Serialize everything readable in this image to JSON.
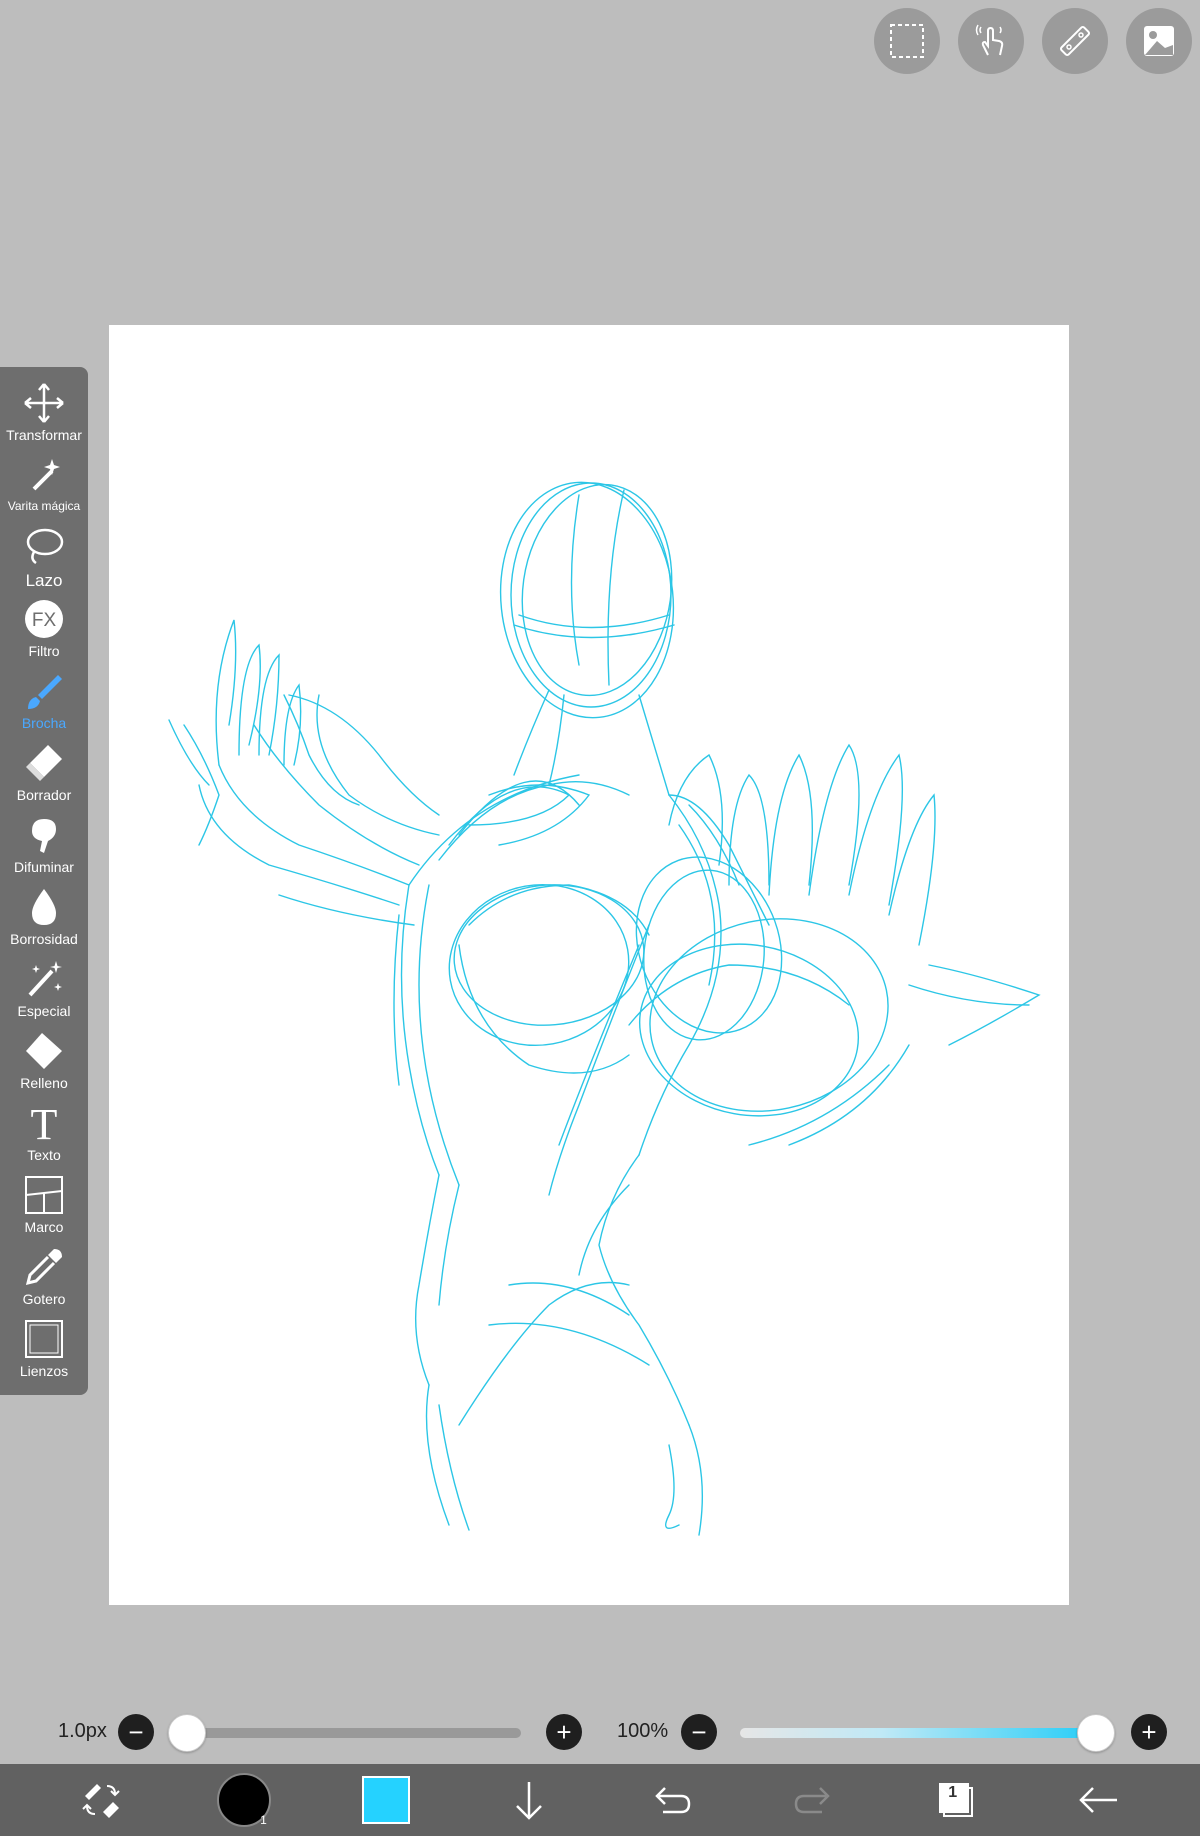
{
  "top_buttons": [
    {
      "name": "selection-icon"
    },
    {
      "name": "gesture-icon"
    },
    {
      "name": "ruler-icon"
    },
    {
      "name": "material-icon"
    }
  ],
  "toolbar": {
    "tools": [
      {
        "id": "transformar",
        "label": "Transformar",
        "icon": "move-icon"
      },
      {
        "id": "varita",
        "label": "Varita mágica",
        "icon": "magic-wand-icon"
      },
      {
        "id": "lazo",
        "label": "Lazo",
        "icon": "lasso-icon"
      },
      {
        "id": "filtro",
        "label": "Filtro",
        "icon": "fx-icon"
      },
      {
        "id": "brocha",
        "label": "Brocha",
        "icon": "brush-icon",
        "active": true
      },
      {
        "id": "borrador",
        "label": "Borrador",
        "icon": "eraser-icon"
      },
      {
        "id": "difuminar",
        "label": "Difuminar",
        "icon": "smudge-icon"
      },
      {
        "id": "borrosidad",
        "label": "Borrosidad",
        "icon": "blur-drop-icon"
      },
      {
        "id": "especial",
        "label": "Especial",
        "icon": "special-brush-icon"
      },
      {
        "id": "relleno",
        "label": "Relleno",
        "icon": "fill-icon"
      },
      {
        "id": "texto",
        "label": "Texto",
        "icon": "text-icon"
      },
      {
        "id": "marco",
        "label": "Marco",
        "icon": "frame-icon"
      },
      {
        "id": "gotero",
        "label": "Gotero",
        "icon": "eyedropper-icon"
      },
      {
        "id": "lienzos",
        "label": "Lienzos",
        "icon": "canvas-icon"
      }
    ]
  },
  "brush_size": {
    "label": "1.0px",
    "value_fraction": 0.0
  },
  "opacity": {
    "label": "100%",
    "value_fraction": 1.0
  },
  "colors": {
    "stroke": "#25d2ff",
    "accent": "#4aa8ff"
  },
  "bottom_bar": {
    "layer_count": "1",
    "brush_preview_number": "1"
  }
}
